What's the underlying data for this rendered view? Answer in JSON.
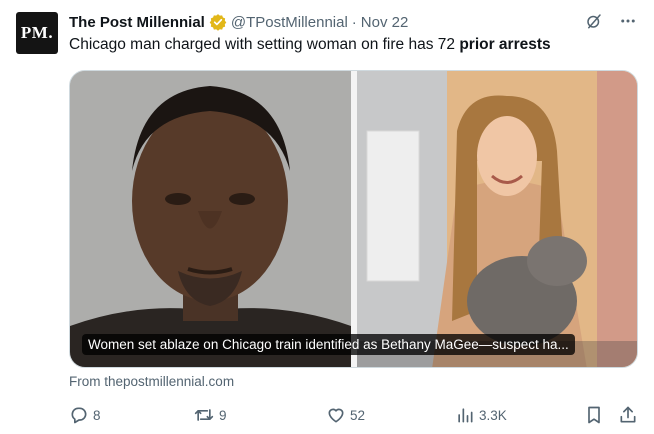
{
  "avatar": {
    "text": "PM."
  },
  "header": {
    "name": "The Post Millennial",
    "handle": "@TPostMillennial",
    "separator": "·",
    "date": "Nov 22"
  },
  "icons": {
    "verified": "verified-badge-icon",
    "grok": "grok-icon",
    "more": "more-icon",
    "reply": "reply-icon",
    "retweet": "retweet-icon",
    "like": "like-icon",
    "views": "views-icon",
    "bookmark": "bookmark-icon",
    "share": "share-icon"
  },
  "colors": {
    "verified": "#e2b719",
    "muted": "#536471",
    "text": "#0f1419"
  },
  "tweet": {
    "text_plain": "Chicago man charged with setting woman on fire has 72 ",
    "text_bold": "prior arrests"
  },
  "card": {
    "caption": "Women set ablaze on Chicago train identified as Bethany MaGee—suspect ha...",
    "source": "From thepostmillennial.com"
  },
  "actions": {
    "replies": "8",
    "reposts": "9",
    "likes": "52",
    "views": "3.3K"
  }
}
